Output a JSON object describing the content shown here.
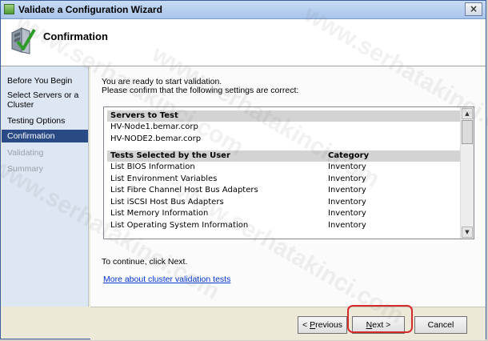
{
  "window": {
    "title": "Validate a Configuration Wizard",
    "close_glyph": "×",
    "app_icon": "wizard-app-icon"
  },
  "header": {
    "title": "Confirmation",
    "icon": "cluster-validation-icon"
  },
  "nav": {
    "items": [
      {
        "label": "Before You Begin",
        "state": "normal"
      },
      {
        "label": "Select Servers or a Cluster",
        "state": "normal"
      },
      {
        "label": "Testing Options",
        "state": "normal"
      },
      {
        "label": "Confirmation",
        "state": "active"
      },
      {
        "label": "Validating",
        "state": "disabled"
      },
      {
        "label": "Summary",
        "state": "disabled"
      }
    ]
  },
  "content": {
    "intro_line1": "You are ready to start validation.",
    "intro_line2": "Please confirm that the following settings are correct:",
    "servers_header": "Servers to Test",
    "servers": [
      "HV-Node1.bemar.corp",
      "HV-NODE2.bemar.corp"
    ],
    "tests_header": "Tests Selected by the User",
    "category_header": "Category",
    "tests": [
      {
        "name": "List BIOS Information",
        "category": "Inventory"
      },
      {
        "name": "List Environment Variables",
        "category": "Inventory"
      },
      {
        "name": "List Fibre Channel Host Bus Adapters",
        "category": "Inventory"
      },
      {
        "name": "List iSCSI Host Bus Adapters",
        "category": "Inventory"
      },
      {
        "name": "List Memory Information",
        "category": "Inventory"
      },
      {
        "name": "List Operating System Information",
        "category": "Inventory"
      }
    ],
    "continue_text": "To continue, click Next.",
    "more_link": "More about cluster validation tests"
  },
  "buttons": {
    "previous": {
      "prefix": "< ",
      "key": "P",
      "rest": "revious"
    },
    "next": {
      "key": "N",
      "rest": "ext",
      "suffix": " >"
    },
    "cancel": "Cancel"
  },
  "scrollbar": {
    "up": "▲",
    "down": "▼"
  },
  "watermark": "www.serhatakinci.com",
  "colors": {
    "active_nav": "#2a4a85",
    "highlight": "#d42a2a",
    "link": "#0033cc"
  }
}
